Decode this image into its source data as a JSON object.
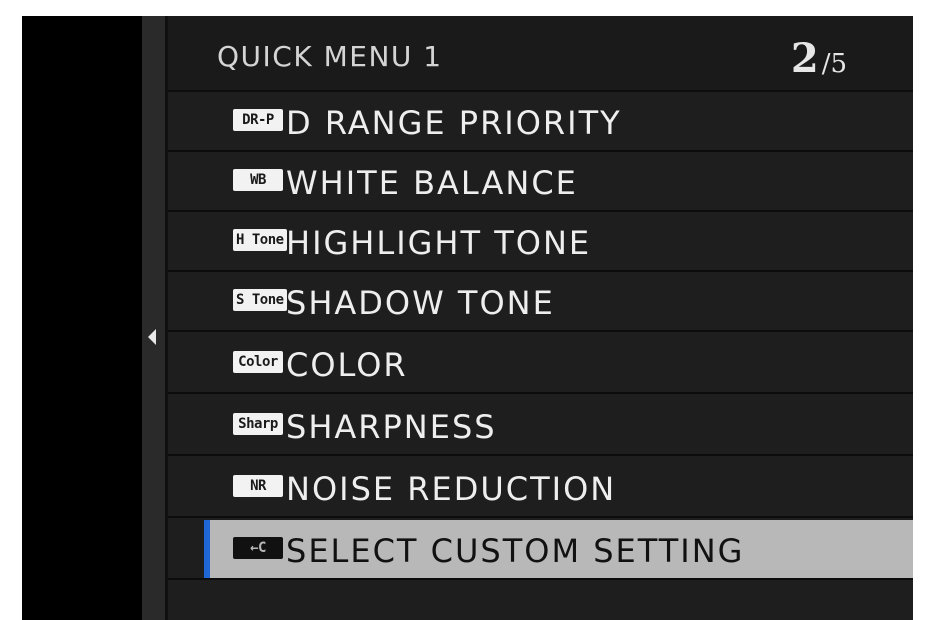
{
  "header": {
    "title": "QUICK MENU 1",
    "page_current": "2",
    "page_separator": "/",
    "page_total": "5"
  },
  "items": [
    {
      "badge": "DR-P",
      "label": "D RANGE PRIORITY",
      "icon": "dr-priority-icon",
      "selected": false
    },
    {
      "badge": "WB",
      "label": "WHITE BALANCE",
      "icon": "white-balance-icon",
      "selected": false
    },
    {
      "badge": "H Tone",
      "label": "HIGHLIGHT TONE",
      "icon": "highlight-tone-icon",
      "selected": false
    },
    {
      "badge": "S Tone",
      "label": "SHADOW TONE",
      "icon": "shadow-tone-icon",
      "selected": false
    },
    {
      "badge": "Color",
      "label": "COLOR",
      "icon": "color-icon",
      "selected": false
    },
    {
      "badge": "Sharp",
      "label": "SHARPNESS",
      "icon": "sharpness-icon",
      "selected": false
    },
    {
      "badge": "NR",
      "label": "NOISE REDUCTION",
      "icon": "noise-reduction-icon",
      "selected": false
    },
    {
      "badge": "←C",
      "label": "SELECT CUSTOM SETTING",
      "icon": "select-custom-setting-icon",
      "selected": true
    }
  ],
  "colors": {
    "cursor": "#1f66d6",
    "selected_row": "#b8b8b8",
    "background": "#1e1e1e"
  }
}
